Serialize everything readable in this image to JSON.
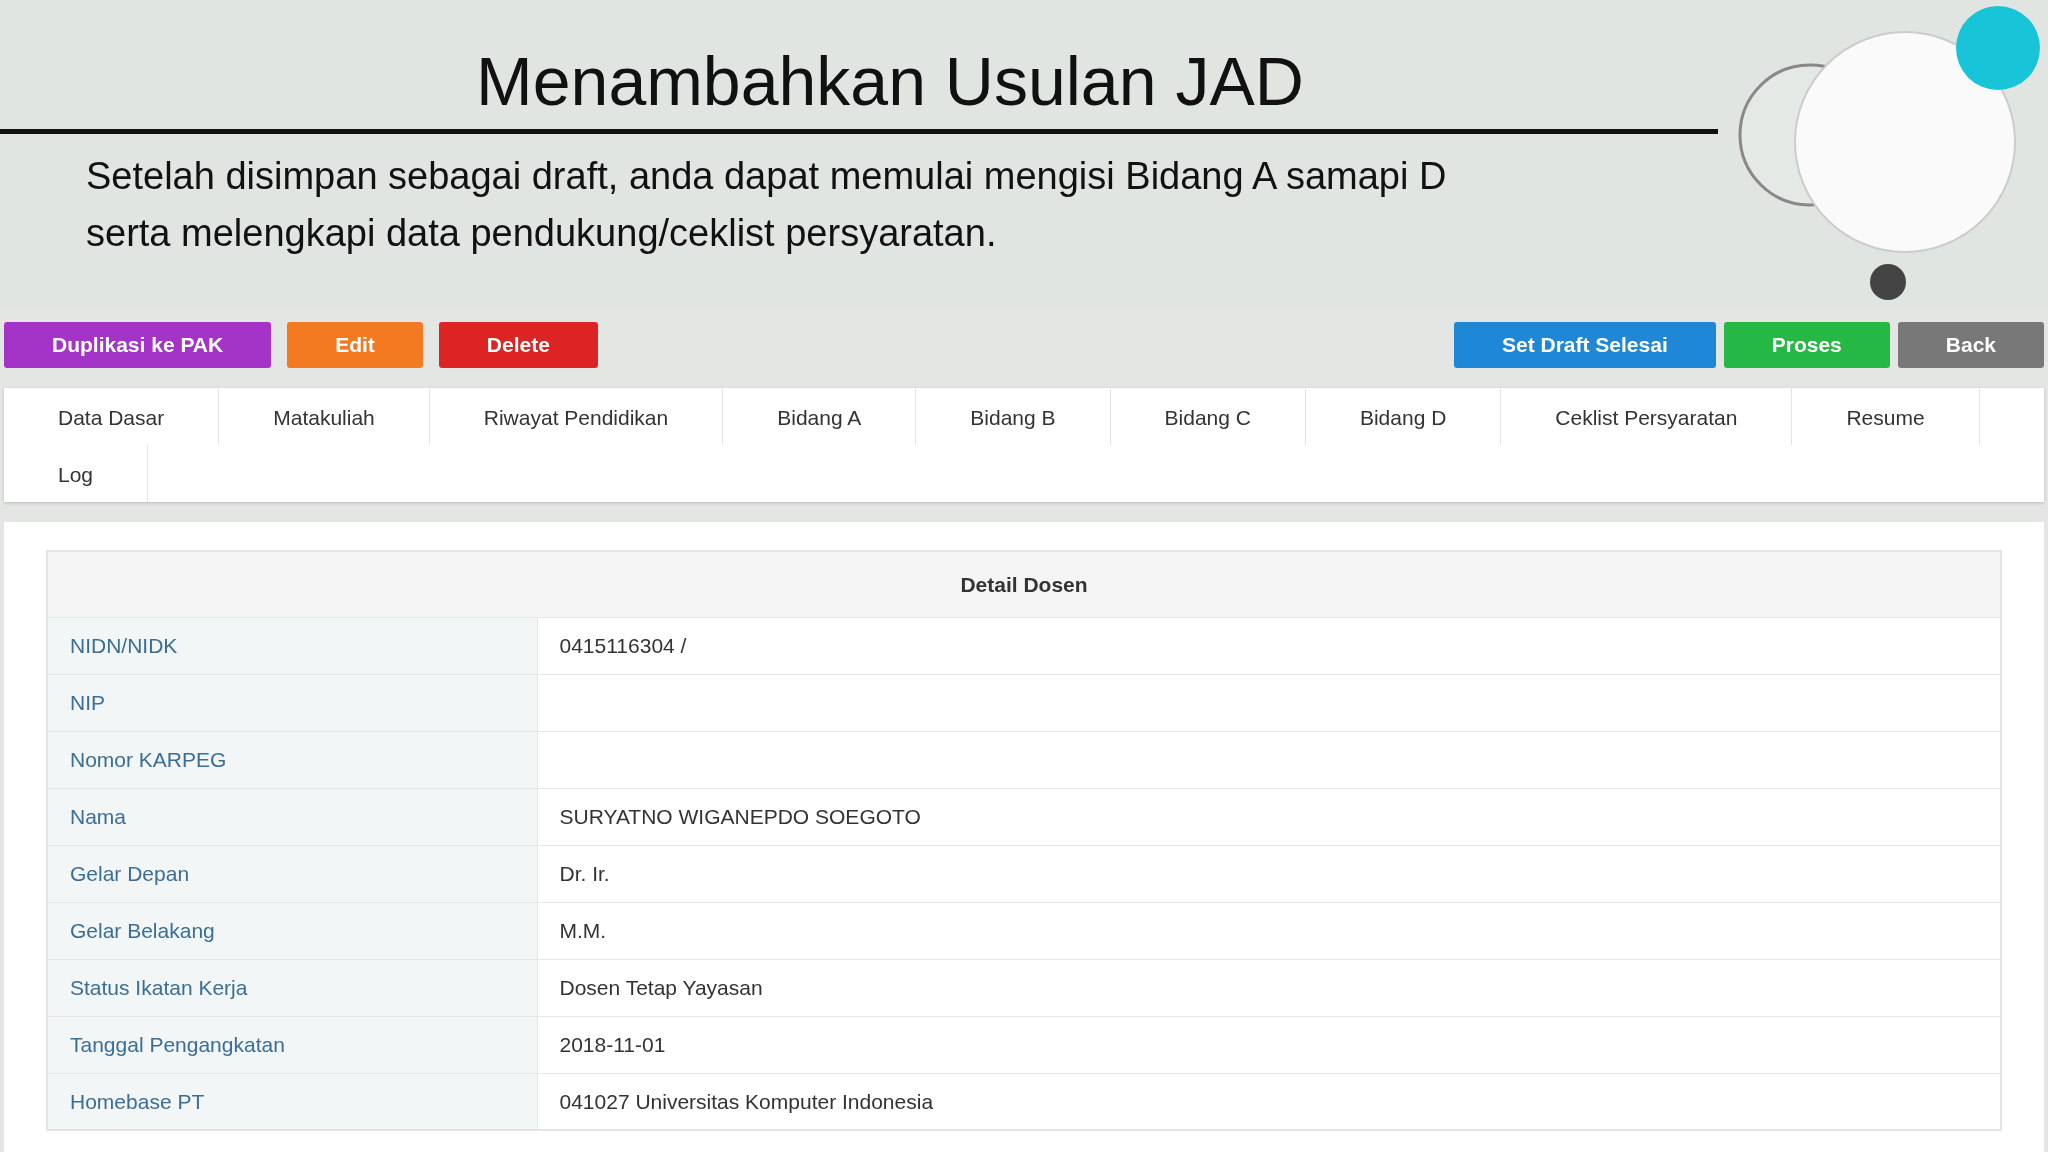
{
  "slide": {
    "title": "Menambahkan Usulan JAD",
    "description": "Setelah disimpan sebagai draft, anda dapat memulai mengisi Bidang A samapi D serta melengkapi data pendukung/ceklist persyaratan."
  },
  "left_buttons": [
    {
      "label": "Duplikasi ke PAK",
      "color": "#a434c8"
    },
    {
      "label": "Edit",
      "color": "#f47a22"
    },
    {
      "label": "Delete",
      "color": "#dc2424"
    }
  ],
  "right_buttons": [
    {
      "label": "Set Draft Selesai",
      "color": "#1f88d6"
    },
    {
      "label": "Proses",
      "color": "#25b845"
    },
    {
      "label": "Back",
      "color": "#787878"
    }
  ],
  "tabs": [
    "Data Dasar",
    "Matakuliah",
    "Riwayat Pendidikan",
    "Bidang A",
    "Bidang B",
    "Bidang C",
    "Bidang D",
    "Ceklist Persyaratan",
    "Resume",
    "Log"
  ],
  "table": {
    "title": "Detail Dosen",
    "rows": [
      {
        "label": "NIDN/NIDK",
        "value": "0415116304 /"
      },
      {
        "label": "NIP"
      },
      {
        "label": "Nomor KARPEG"
      },
      {
        "label": "Nama",
        "value": "SURYATNO WIGANEPDO SOEGOTO"
      },
      {
        "label": "Gelar Depan",
        "value": "Dr. Ir."
      },
      {
        "label": "Gelar Belakang",
        "value": "M.M."
      },
      {
        "label": "Status Ikatan Kerja",
        "value": "Dosen Tetap Yayasan"
      },
      {
        "label": "Tanggal Pengangkatan",
        "value": "2018-11-01"
      },
      {
        "label": "Homebase PT",
        "value": "041027 Universitas Komputer Indonesia"
      }
    ]
  }
}
